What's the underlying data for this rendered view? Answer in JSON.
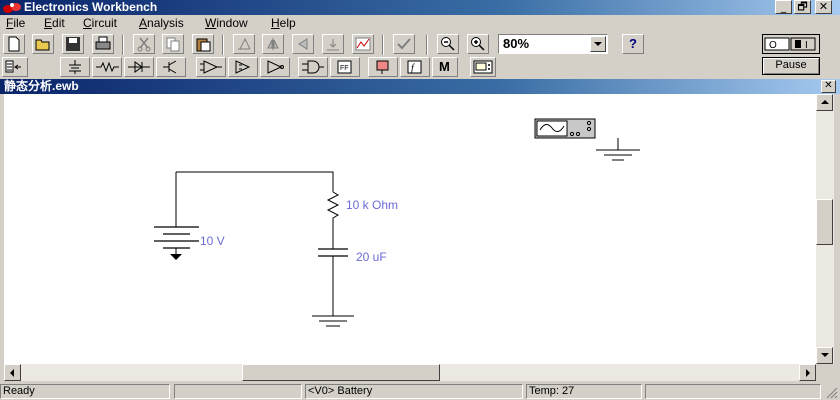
{
  "app": {
    "title": "Electronics Workbench"
  },
  "window_controls": {
    "minimize": "_",
    "restore": "🗗",
    "close": "✕"
  },
  "menu": {
    "items": [
      {
        "label": "File",
        "u": "F",
        "rest": "ile"
      },
      {
        "label": "Edit",
        "u": "E",
        "rest": "dit"
      },
      {
        "label": "Circuit",
        "u": "C",
        "rest": "ircuit"
      },
      {
        "label": "Analysis",
        "u": "A",
        "rest": "nalysis"
      },
      {
        "label": "Window",
        "u": "W",
        "rest": "indow"
      },
      {
        "label": "Help",
        "u": "H",
        "rest": "elp"
      }
    ]
  },
  "toolbar": {
    "zoom": "80%",
    "help_label": "?",
    "pause_label": "Pause"
  },
  "component_toolbar": {
    "memory_label": "M"
  },
  "document": {
    "title": "静态分析.ewb",
    "close_label": "✕"
  },
  "circuit": {
    "battery_label": "10 V",
    "resistor_label": "10 k Ohm",
    "capacitor_label": "20 uF"
  },
  "status": {
    "ready": "Ready",
    "panel2": "",
    "component": "<V0> Battery",
    "temp": "Temp:  27",
    "panel5": ""
  }
}
